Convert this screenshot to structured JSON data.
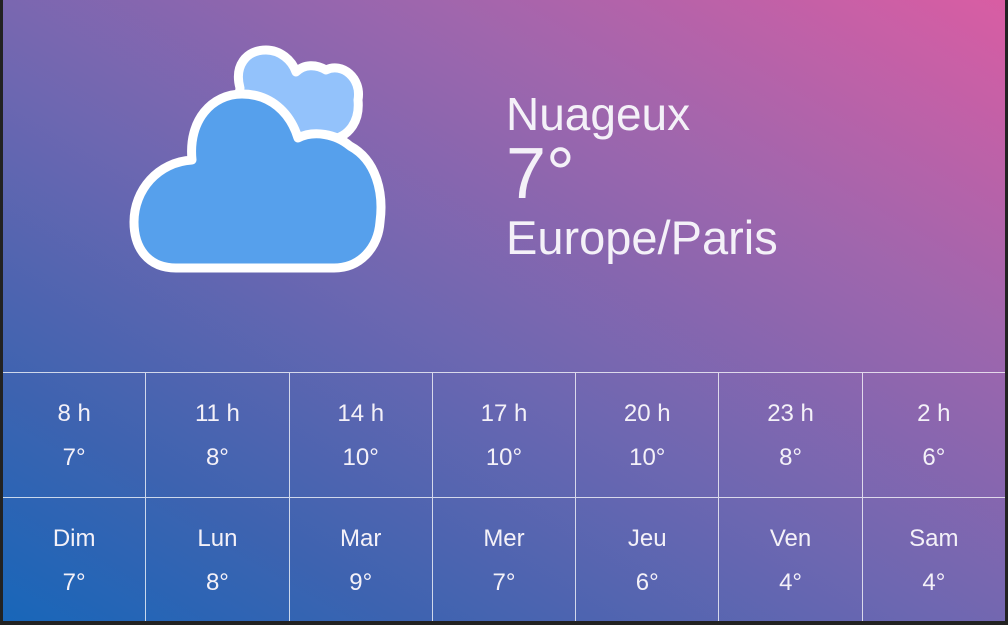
{
  "current": {
    "condition": "Nuageux",
    "temperature": "7°",
    "location": "Europe/Paris",
    "icon": "cloudy-icon"
  },
  "hourly": [
    {
      "label": "8 h",
      "temp": "7°"
    },
    {
      "label": "11 h",
      "temp": "8°"
    },
    {
      "label": "14 h",
      "temp": "10°"
    },
    {
      "label": "17 h",
      "temp": "10°"
    },
    {
      "label": "20 h",
      "temp": "10°"
    },
    {
      "label": "23 h",
      "temp": "8°"
    },
    {
      "label": "2 h",
      "temp": "6°"
    }
  ],
  "daily": [
    {
      "label": "Dim",
      "temp": "7°"
    },
    {
      "label": "Lun",
      "temp": "8°"
    },
    {
      "label": "Mar",
      "temp": "9°"
    },
    {
      "label": "Mer",
      "temp": "7°"
    },
    {
      "label": "Jeu",
      "temp": "6°"
    },
    {
      "label": "Ven",
      "temp": "4°"
    },
    {
      "label": "Sam",
      "temp": "4°"
    }
  ],
  "colors": {
    "cloud_front": "#56a0ec",
    "cloud_back": "#93c2fb",
    "cloud_outline": "#ffffff",
    "text": "#f4f1f8"
  }
}
